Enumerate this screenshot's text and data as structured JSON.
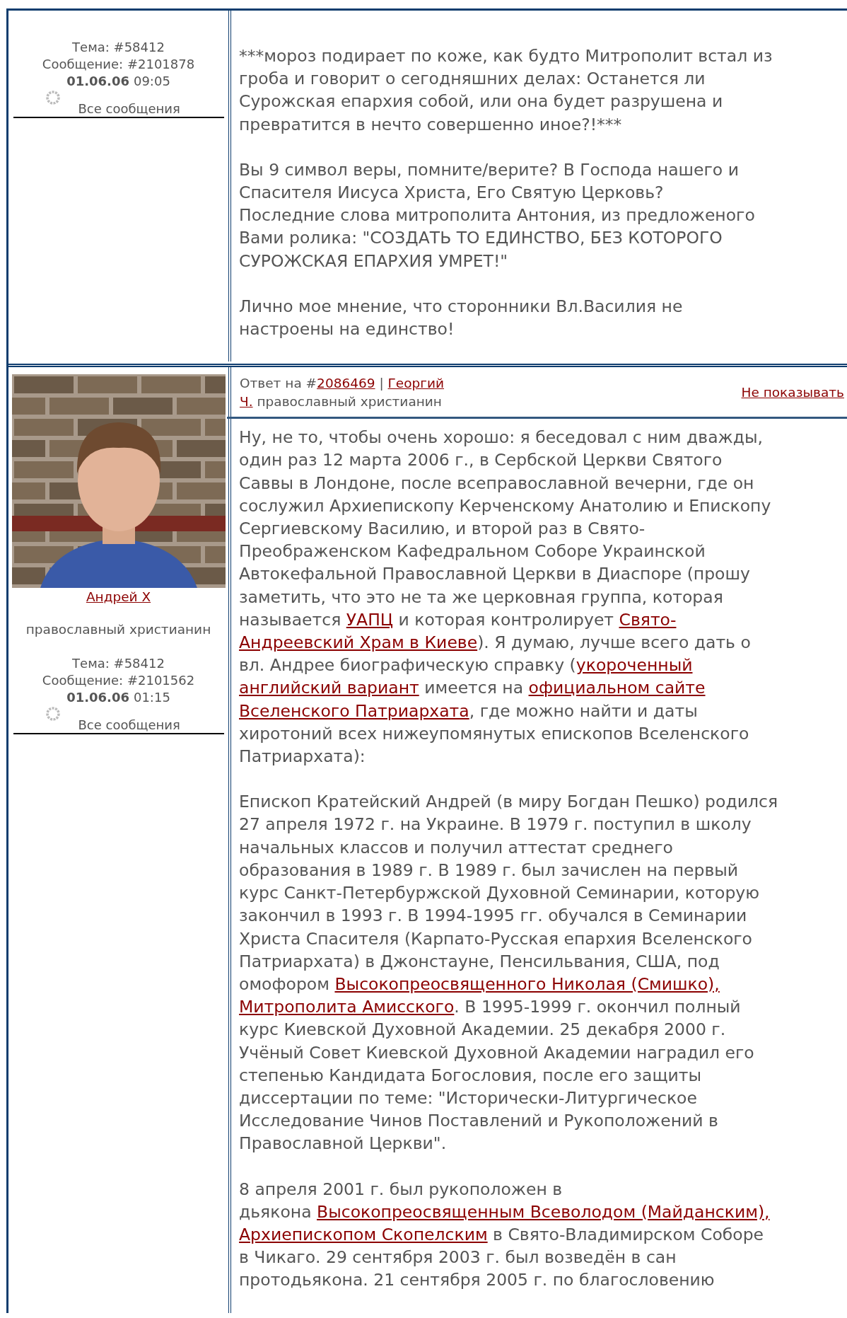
{
  "posts": [
    {
      "meta": {
        "topic": "Тема: #58412",
        "message": "Сообщение: #2101878",
        "date": "01.06.06",
        "time": "09:05",
        "all_link": "Все сообщения"
      },
      "body": [
        [
          [
            "***мороз подирает по коже, как будто Митрополит встал из"
          ],
          [
            "гроба и говорит о сегодняшних делах: Останется ли"
          ],
          [
            "Сурожская епархия собой, или она будет разрушена и"
          ],
          [
            "превратится в нечто совершенно иное?!***"
          ]
        ],
        [
          [
            "Вы 9 символ веры, помните/верите? В Господа нашего и"
          ],
          [
            "Спасителя Иисуса Христа, Его Святую Церковь?"
          ],
          [
            "Последние слова митрополита Антония, из предложеного"
          ],
          [
            "Вами ролика: \"СОЗДАТЬ ТО ЕДИНСТВО, БЕЗ КОТОРОГО"
          ],
          [
            "СУРОЖСКАЯ ЕПАРХИЯ УМРЕТ!\""
          ]
        ],
        [
          [
            "Лично мое мнение, что сторонники Вл.Василия не"
          ],
          [
            "настроены на единство!"
          ]
        ]
      ]
    },
    {
      "author": {
        "name": "Андрей Х",
        "rank": "православный христианин"
      },
      "header": {
        "lines": [
          [
            "Ответ на #",
            {
              "link": "2086469"
            },
            " | ",
            {
              "link": "Георгий"
            }
          ],
          [
            {
              "link": "Ч."
            },
            " православный христианин"
          ]
        ],
        "hide_link": "Не показывать"
      },
      "meta": {
        "topic": "Тема: #58412",
        "message": "Сообщение: #2101562",
        "date": "01.06.06",
        "time": "01:15",
        "all_link": "Все сообщения"
      },
      "body": [
        [
          [
            "Ну, не то, чтобы очень хорошо: я беседовал с ним дважды,"
          ],
          [
            "один раз 12 марта 2006 г., в Сербской Церкви Святого"
          ],
          [
            "Саввы в Лондоне, после всеправославной вечерни, где он"
          ],
          [
            "сослужил Архиепископу Керченскому Анатолию и Епископу"
          ],
          [
            "Сергиевскому Василию, и второй раз в Свято-"
          ],
          [
            "Преображенском Кафедральном Соборе Украинской"
          ],
          [
            "Автокефальной Православной Церкви в Диаспоре (прошу"
          ],
          [
            "заметить, что это не та же церковная группа, которая"
          ],
          [
            "называется ",
            {
              "link": "УАПЦ"
            },
            " и которая контролирует ",
            {
              "link": "Свято-"
            }
          ],
          [
            {
              "link": "Андреевский Храм в Киеве"
            },
            "). Я думаю, лучше всего дать о"
          ],
          [
            "вл. Андрее биографическую справку (",
            {
              "link": "укороченный"
            }
          ],
          [
            {
              "link": "английский вариант"
            },
            " имеется на ",
            {
              "link": "официальном сайте"
            }
          ],
          [
            {
              "link": "Вселенского Патриархата"
            },
            ", где можно найти и даты"
          ],
          [
            "хиротоний всех нижеупомянутых епископов Вселенского"
          ],
          [
            "Патриархата):"
          ]
        ],
        [
          [
            "Епископ Кратейский Андрей (в миру Богдан Пешко) родился"
          ],
          [
            "27 апреля 1972 г. на Украине. В 1979 г. поступил в школу"
          ],
          [
            "начальных классов и получил аттестат среднего"
          ],
          [
            "образования в 1989 г. В 1989 г. был зачислен на первый"
          ],
          [
            "курс Санкт-Петербуржской Духовной Семинарии, которую"
          ],
          [
            "закончил в 1993 г. В 1994-1995 гг. обучался в Семинарии"
          ],
          [
            "Христа Спасителя (Карпато-Русская епархия Вселенского"
          ],
          [
            "Патриархата) в Джонстауне, Пенсильвания, США, под"
          ],
          [
            "омофором ",
            {
              "link": "Высокопреосвященного Николая (Смишко),"
            }
          ],
          [
            {
              "link": "Митрополита Амисского"
            },
            ". В 1995-1999 г. окончил полный"
          ],
          [
            "курс Киевской Духовной Академии. 25 декабря 2000 г."
          ],
          [
            "Учёный Совет Киевской Духовной Академии наградил его"
          ],
          [
            "степенью Кандидата Богословия, после его защиты"
          ],
          [
            "диссертации по теме: \"Исторически-Литургическое"
          ],
          [
            "Исследование Чинов Поставлений и Рукоположений в"
          ],
          [
            "Православной Церкви\"."
          ]
        ],
        [
          [
            "8 апреля 2001 г. был рукоположен в"
          ],
          [
            "дьякона ",
            {
              "link": "Высокопреосвященным Всеволодом (Майданским),"
            }
          ],
          [
            {
              "link": "Архиепископом Скопелским"
            },
            " в Свято-Владимирском Соборе"
          ],
          [
            "в Чикаго. 29 сентября 2003 г. был возведён в сан"
          ],
          [
            "протодьякона. 21 сентября 2005 г. по благословению"
          ]
        ]
      ]
    }
  ]
}
